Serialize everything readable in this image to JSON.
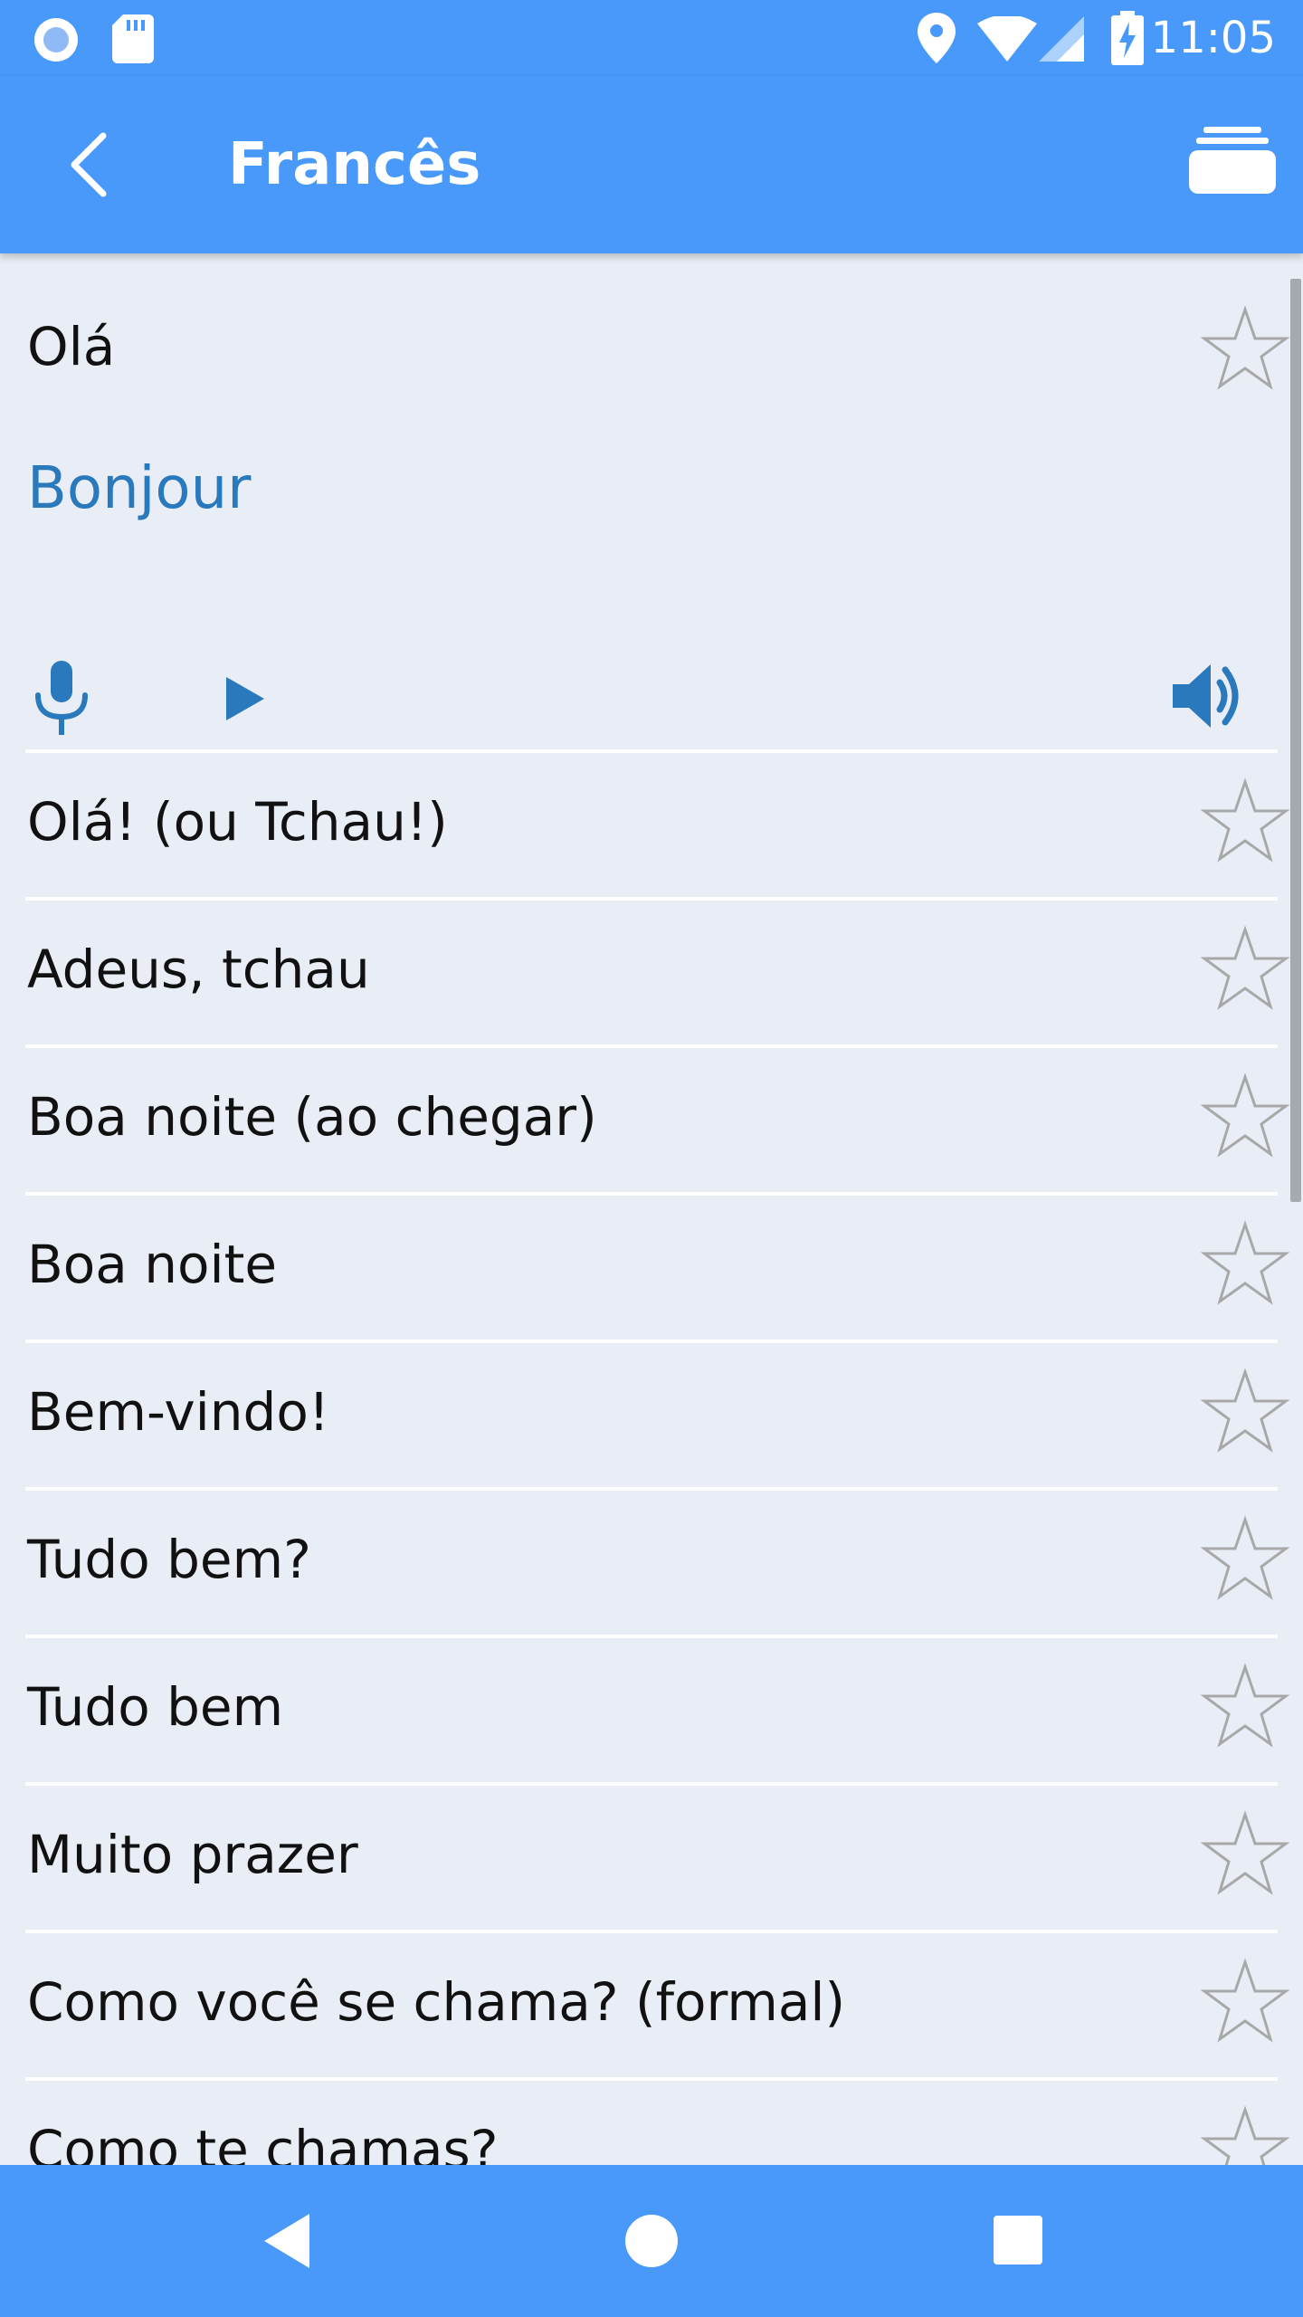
{
  "status_bar": {
    "time": "11:05",
    "icons": [
      "record-icon",
      "sd-card-icon",
      "location-icon",
      "wifi-icon",
      "signal-icon",
      "battery-charging-icon"
    ]
  },
  "app_bar": {
    "title": "Francês",
    "back_icon": "chevron-left-icon",
    "action_icon": "stack-icon"
  },
  "header_card": {
    "source_text": "Olá",
    "translation_text": "Bonjour",
    "icons": [
      "star-icon",
      "microphone-icon",
      "play-icon",
      "speaker-icon"
    ]
  },
  "phrases": [
    {
      "label": "Olá! (ou Tchau!)"
    },
    {
      "label": "Adeus, tchau"
    },
    {
      "label": "Boa noite (ao chegar)"
    },
    {
      "label": "Boa noite"
    },
    {
      "label": "Bem-vindo!"
    },
    {
      "label": "Tudo bem?"
    },
    {
      "label": "Tudo bem"
    },
    {
      "label": "Muito prazer"
    },
    {
      "label": "Como você se chama? (formal)"
    },
    {
      "label": "Como te chamas?"
    }
  ],
  "nav_bar": {
    "icons": [
      "nav-back-icon",
      "nav-home-icon",
      "nav-recents-icon"
    ]
  },
  "colors": {
    "primary": "#4899f9",
    "background": "#e9eef6",
    "accent_text": "#2a79bd",
    "star_outline": "#a8a8a8"
  }
}
